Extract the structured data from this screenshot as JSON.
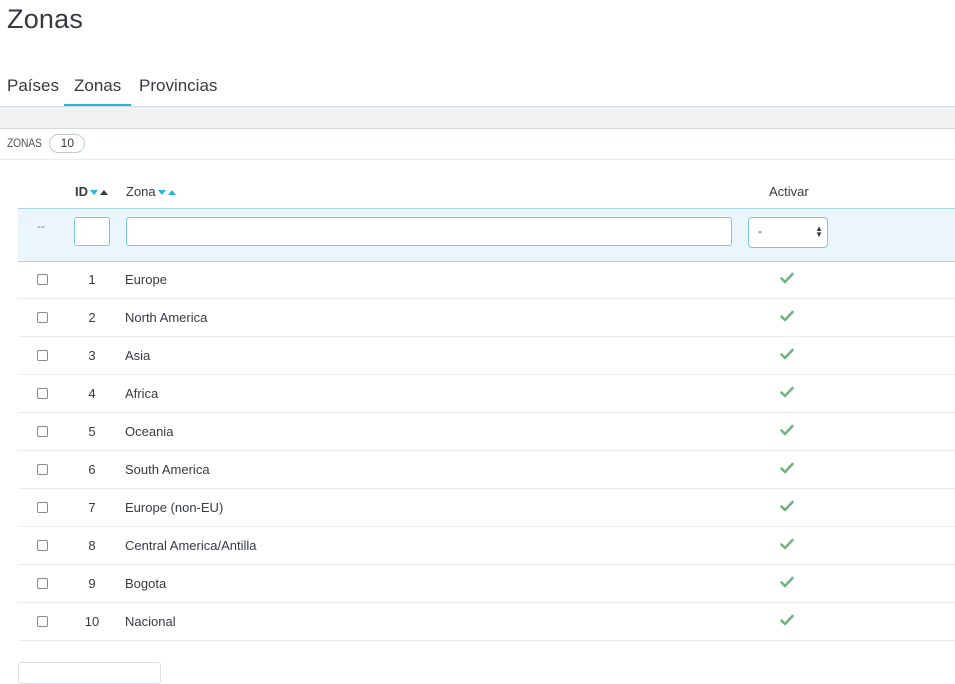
{
  "page": {
    "title": "Zonas"
  },
  "tabs": [
    {
      "label": "Países",
      "active": false
    },
    {
      "label": "Zonas",
      "active": true
    },
    {
      "label": "Provincias",
      "active": false
    }
  ],
  "panel": {
    "label": "ZONAS",
    "count": "10"
  },
  "table": {
    "columns": {
      "id": "ID",
      "zona": "Zona",
      "activar": "Activar"
    },
    "filter": {
      "dash": "--",
      "select_value": "-"
    },
    "rows": [
      {
        "id": "1",
        "zona": "Europe",
        "active": true
      },
      {
        "id": "2",
        "zona": "North America",
        "active": true
      },
      {
        "id": "3",
        "zona": "Asia",
        "active": true
      },
      {
        "id": "4",
        "zona": "Africa",
        "active": true
      },
      {
        "id": "5",
        "zona": "Oceania",
        "active": true
      },
      {
        "id": "6",
        "zona": "South America",
        "active": true
      },
      {
        "id": "7",
        "zona": "Europe (non-EU)",
        "active": true
      },
      {
        "id": "8",
        "zona": "Central America/Antilla",
        "active": true
      },
      {
        "id": "9",
        "zona": "Bogota",
        "active": true
      },
      {
        "id": "10",
        "zona": "Nacional",
        "active": true
      }
    ]
  },
  "colors": {
    "accent": "#25b9d7",
    "check": "#70b580",
    "text": "#363a41"
  }
}
